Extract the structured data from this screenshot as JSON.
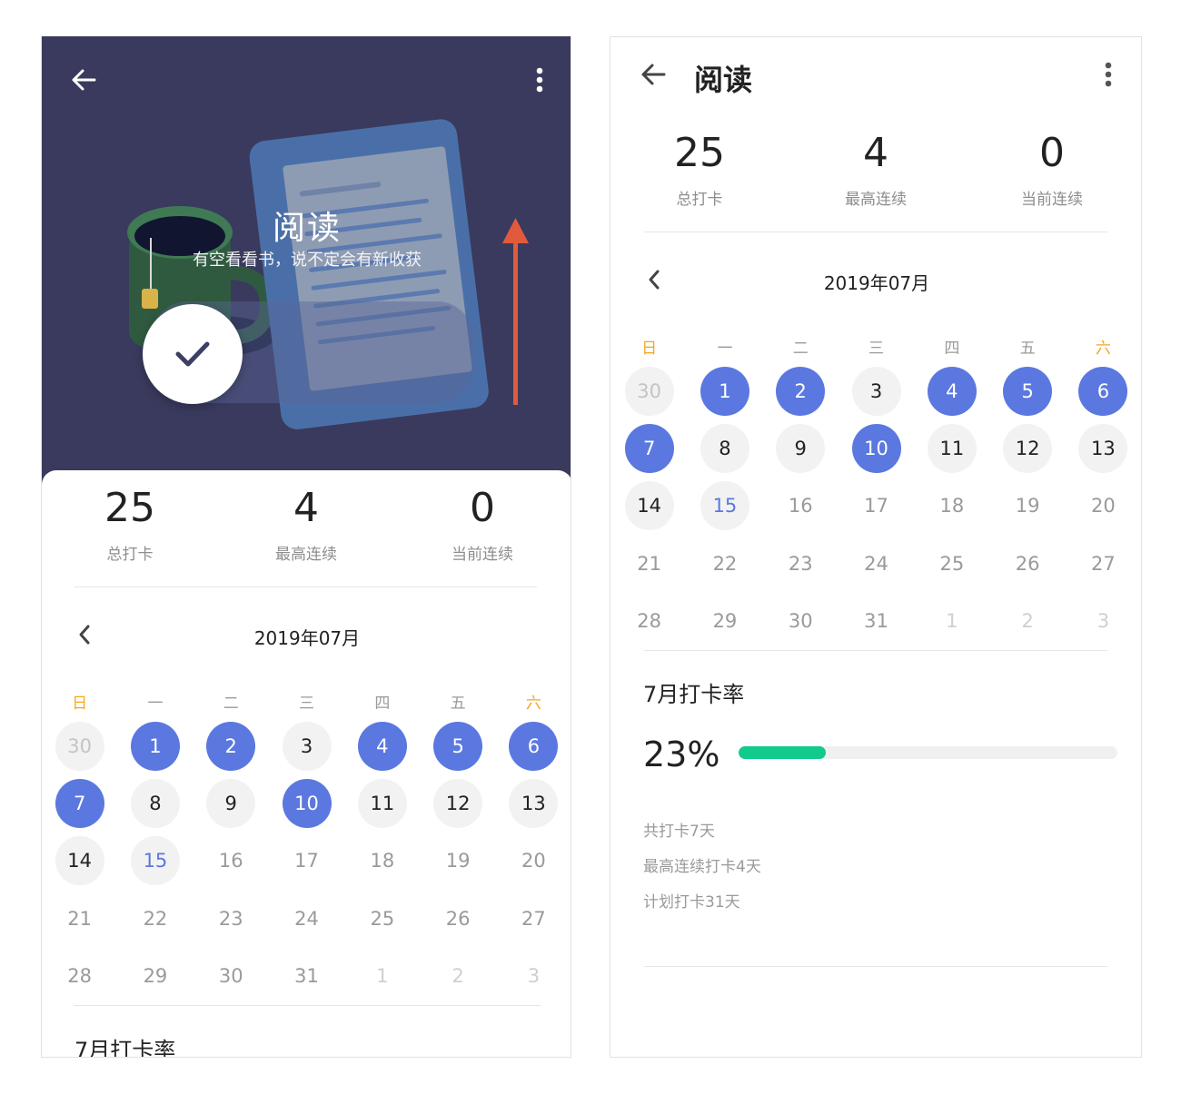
{
  "screen1": {
    "hero": {
      "title": "阅读",
      "subtitle": "有空看看书，说不定会有新收获"
    }
  },
  "screen2": {
    "title": "阅读"
  },
  "stats": [
    {
      "value": "25",
      "label": "总打卡"
    },
    {
      "value": "4",
      "label": "最高连续"
    },
    {
      "value": "0",
      "label": "当前连续"
    }
  ],
  "calendar": {
    "month_label": "2019年07月",
    "weekdays": [
      "日",
      "一",
      "二",
      "三",
      "四",
      "五",
      "六"
    ],
    "weekend_color": "#f5a623",
    "checked_color": "#5b78e0",
    "days": [
      {
        "n": "30",
        "s": "prevmon"
      },
      {
        "n": "1",
        "s": "checked"
      },
      {
        "n": "2",
        "s": "checked"
      },
      {
        "n": "3",
        "s": "past"
      },
      {
        "n": "4",
        "s": "checked"
      },
      {
        "n": "5",
        "s": "checked"
      },
      {
        "n": "6",
        "s": "checked"
      },
      {
        "n": "7",
        "s": "checked"
      },
      {
        "n": "8",
        "s": "past"
      },
      {
        "n": "9",
        "s": "past"
      },
      {
        "n": "10",
        "s": "checked"
      },
      {
        "n": "11",
        "s": "past"
      },
      {
        "n": "12",
        "s": "past"
      },
      {
        "n": "13",
        "s": "past"
      },
      {
        "n": "14",
        "s": "past"
      },
      {
        "n": "15",
        "s": "today"
      },
      {
        "n": "16",
        "s": "future"
      },
      {
        "n": "17",
        "s": "future"
      },
      {
        "n": "18",
        "s": "future"
      },
      {
        "n": "19",
        "s": "future"
      },
      {
        "n": "20",
        "s": "future"
      },
      {
        "n": "21",
        "s": "future"
      },
      {
        "n": "22",
        "s": "future"
      },
      {
        "n": "23",
        "s": "future"
      },
      {
        "n": "24",
        "s": "future"
      },
      {
        "n": "25",
        "s": "future"
      },
      {
        "n": "26",
        "s": "future"
      },
      {
        "n": "27",
        "s": "future"
      },
      {
        "n": "28",
        "s": "future"
      },
      {
        "n": "29",
        "s": "future"
      },
      {
        "n": "30",
        "s": "future"
      },
      {
        "n": "31",
        "s": "future"
      },
      {
        "n": "1",
        "s": "nextmon"
      },
      {
        "n": "2",
        "s": "nextmon"
      },
      {
        "n": "3",
        "s": "nextmon"
      }
    ]
  },
  "rate": {
    "title": "7月打卡率",
    "percent_label": "23%",
    "fraction": 0.23,
    "bar_color": "#12c98e",
    "summary": [
      "共打卡7天",
      "最高连续打卡4天",
      "计划打卡31天"
    ]
  },
  "icons": {
    "back": "arrow-left-icon",
    "more": "more-vertical-icon",
    "prev_month": "chevron-left-icon",
    "check": "check-icon"
  },
  "colors": {
    "hero_bg": "#393a5d",
    "accent": "#5b78e0",
    "progress": "#12c98e"
  }
}
